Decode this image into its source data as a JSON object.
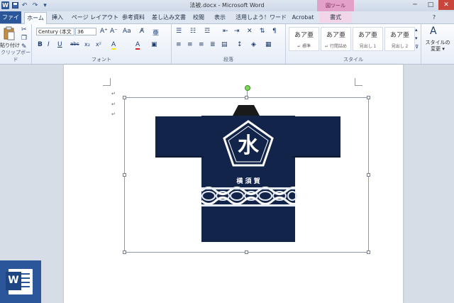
{
  "window": {
    "title": "法被.docx - Microsoft Word",
    "app_icon": "W",
    "context_tool": "図ツール",
    "controls": {
      "minimize": "─",
      "maximize": "□",
      "close": "✕"
    }
  },
  "quick_access": {
    "undo": "↶",
    "redo": "↷",
    "customize": "▾"
  },
  "tabs": [
    "ファイル",
    "ホーム",
    "挿入",
    "ページ レイアウト",
    "参考資料",
    "差し込み文書",
    "校閲",
    "表示",
    "活用しよう！ワード",
    "Acrobat",
    "書式"
  ],
  "ribbon": {
    "clipboard": {
      "paste_label": "貼り付け",
      "group_label": "クリップボード"
    },
    "font": {
      "family": "Century (本文",
      "size": "36",
      "group_label": "フォント",
      "buttons": [
        "B",
        "I",
        "U",
        "abc",
        "x₂",
        "x²",
        "A",
        "A"
      ]
    },
    "paragraph": {
      "group_label": "段落"
    },
    "styles": {
      "group_label": "スタイル",
      "items": [
        {
          "preview": "あア亜",
          "name": "↵ 標準"
        },
        {
          "preview": "あア亜",
          "name": "↵ 行間詰め"
        },
        {
          "preview": "あア亜",
          "name": "見出し 1"
        },
        {
          "preview": "あア亜",
          "name": "見出し 2"
        }
      ],
      "change_label_1": "スタイルの",
      "change_label_2": "変更 ▾"
    }
  },
  "document": {
    "paragraph_marks": [
      "↵",
      "↵",
      "↵"
    ],
    "image": {
      "emblem": "水",
      "name_text": "横 須 賀",
      "colors": {
        "navy": "#122449",
        "collar": "#1a1a1a",
        "pattern": "#ffffff"
      }
    }
  },
  "badge": {
    "letter": "W",
    "color": "#2b579a"
  }
}
